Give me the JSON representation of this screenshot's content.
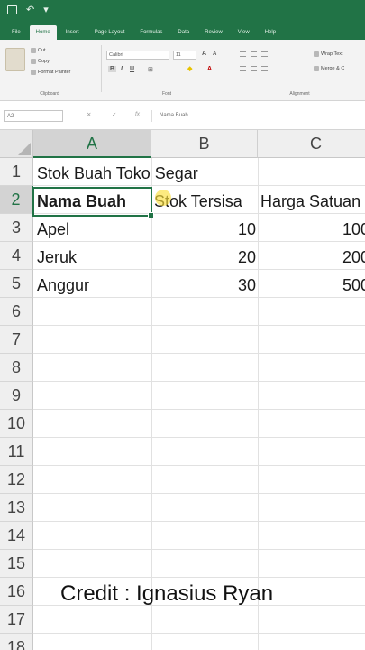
{
  "ribbon": {
    "tabs": [
      "File",
      "Home",
      "Insert",
      "Page Layout",
      "Formulas",
      "Data",
      "Review",
      "View",
      "Help"
    ],
    "active_tab": "Home",
    "clipboard": {
      "cut": "Cut",
      "copy": "Copy",
      "format_painter": "Format Painter",
      "group_label": "Clipboard"
    },
    "font": {
      "name": "Calibri",
      "size": "11",
      "group_label": "Font"
    },
    "alignment": {
      "wrap_text": "Wrap Text",
      "merge": "Merge & C",
      "group_label": "Alignment"
    }
  },
  "formula_bar": {
    "name_box": "A2",
    "content": "Nama Buah"
  },
  "grid": {
    "columns": [
      "A",
      "B",
      "C"
    ],
    "selected_column": "A",
    "rows": [
      "1",
      "2",
      "3",
      "4",
      "5",
      "6",
      "7",
      "8",
      "9",
      "10",
      "11",
      "12",
      "13",
      "14",
      "15",
      "16",
      "17",
      "18"
    ],
    "selected_row": "2",
    "cells": {
      "A1": "Stok Buah Toko Segar",
      "A2": "Nama Buah",
      "B2": "Stok Tersisa",
      "C2": "Harga Satuan",
      "A3": "Apel",
      "B3": "10",
      "C3": "100",
      "A4": "Jeruk",
      "B4": "20",
      "C4": "200",
      "A5": "Anggur",
      "B5": "30",
      "C5": "500"
    }
  },
  "overlay": {
    "credit": "Credit : Ignasius Ryan"
  },
  "colors": {
    "excel_green": "#217346",
    "cursor_highlight": "#fade3c"
  }
}
